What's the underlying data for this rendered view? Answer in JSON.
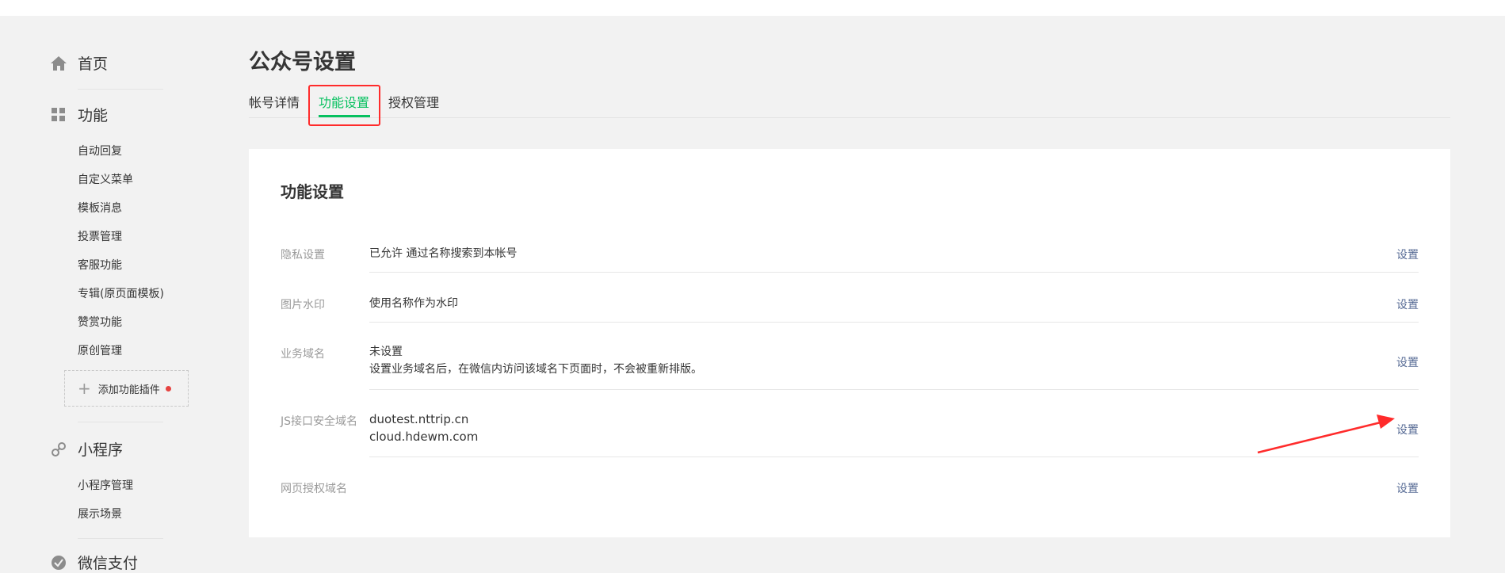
{
  "sidebar": {
    "home": {
      "label": "首页",
      "icon": "home-icon"
    },
    "features": {
      "label": "功能",
      "icon": "grid-icon",
      "items": [
        "自动回复",
        "自定义菜单",
        "模板消息",
        "投票管理",
        "客服功能",
        "专辑(原页面模板)",
        "赞赏功能",
        "原创管理"
      ],
      "add_plugin_label": "添加功能插件"
    },
    "miniprogram": {
      "label": "小程序",
      "icon": "link-icon",
      "items": [
        "小程序管理",
        "展示场景"
      ]
    },
    "wechat_pay": {
      "label": "微信支付",
      "icon": "pay-icon"
    }
  },
  "page": {
    "title": "公众号设置",
    "tabs": [
      {
        "label": "帐号详情",
        "active": false
      },
      {
        "label": "功能设置",
        "active": true
      },
      {
        "label": "授权管理",
        "active": false
      }
    ]
  },
  "card": {
    "title": "功能设置",
    "rows": [
      {
        "label": "隐私设置",
        "values": [
          "已允许 通过名称搜索到本帐号"
        ],
        "action": "设置"
      },
      {
        "label": "图片水印",
        "values": [
          "使用名称作为水印"
        ],
        "action": "设置"
      },
      {
        "label": "业务域名",
        "values": [
          "未设置",
          "设置业务域名后，在微信内访问该域名下页面时，不会被重新排版。"
        ],
        "action": "设置"
      },
      {
        "label": "JS接口安全域名",
        "values": [
          "duotest.nttrip.cn",
          "cloud.hdewm.com"
        ],
        "action": "设置"
      },
      {
        "label": "网页授权域名",
        "values": [],
        "action": "设置"
      }
    ]
  },
  "colors": {
    "accent": "#07c160",
    "link": "#576b95",
    "highlight": "#ff2b2b",
    "badge": "#e64340"
  }
}
